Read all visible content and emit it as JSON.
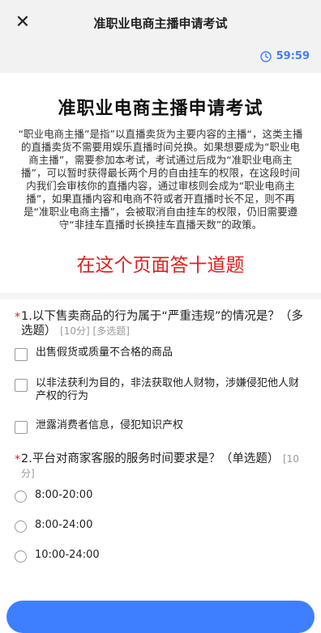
{
  "header": {
    "close_icon": "close-icon",
    "title": "准职业电商主播申请考试"
  },
  "timer": {
    "icon": "clock-icon",
    "value": "59:59"
  },
  "intro": {
    "title": "准职业电商主播申请考试",
    "description": "“职业电商主播”是指”以直播卖货为主要内容的主播“，这类主播的直播卖货不需要用娱乐直播时间兑换。如果想要成为“职业电商主播”，需要参加本考试，考试通过后成为“准职业电商主播”，可以暂时获得最长两个月的自由挂车的权限，在这段时间内我们会审核你的直播内容，通过审核则会成为“职业电商主播”，如果直播内容和电商不符或者开直播时长不足，则不再是“准职业电商主播”，会被取消自由挂车的权限，仍旧需要遵守“非挂车直播时长换挂车直播天数”的政策。",
    "notice": "在这个页面答十道题"
  },
  "questions": [
    {
      "required_mark": "*",
      "title": "1.以下售卖商品的行为属于“严重违规”的情况是？（多选题）",
      "meta": "[10分] [多选题]",
      "options": [
        {
          "label": "出售假货或质量不合格的商品"
        },
        {
          "label": "以非法获利为目的，非法获取他人财物，涉嫌侵犯他人财产权的行为"
        },
        {
          "label": "泄露消费者信息，侵犯知识产权"
        }
      ]
    },
    {
      "required_mark": "*",
      "title": "2.平台对商家客服的服务时间要求是？（单选题）",
      "meta": "[10分]",
      "options": [
        {
          "label": "8:00-20:00"
        },
        {
          "label": "8:00-24:00"
        },
        {
          "label": "10:00-24:00"
        }
      ]
    }
  ],
  "colors": {
    "accent": "#3d7fff",
    "notice": "#e02020",
    "required": "#e02020"
  }
}
